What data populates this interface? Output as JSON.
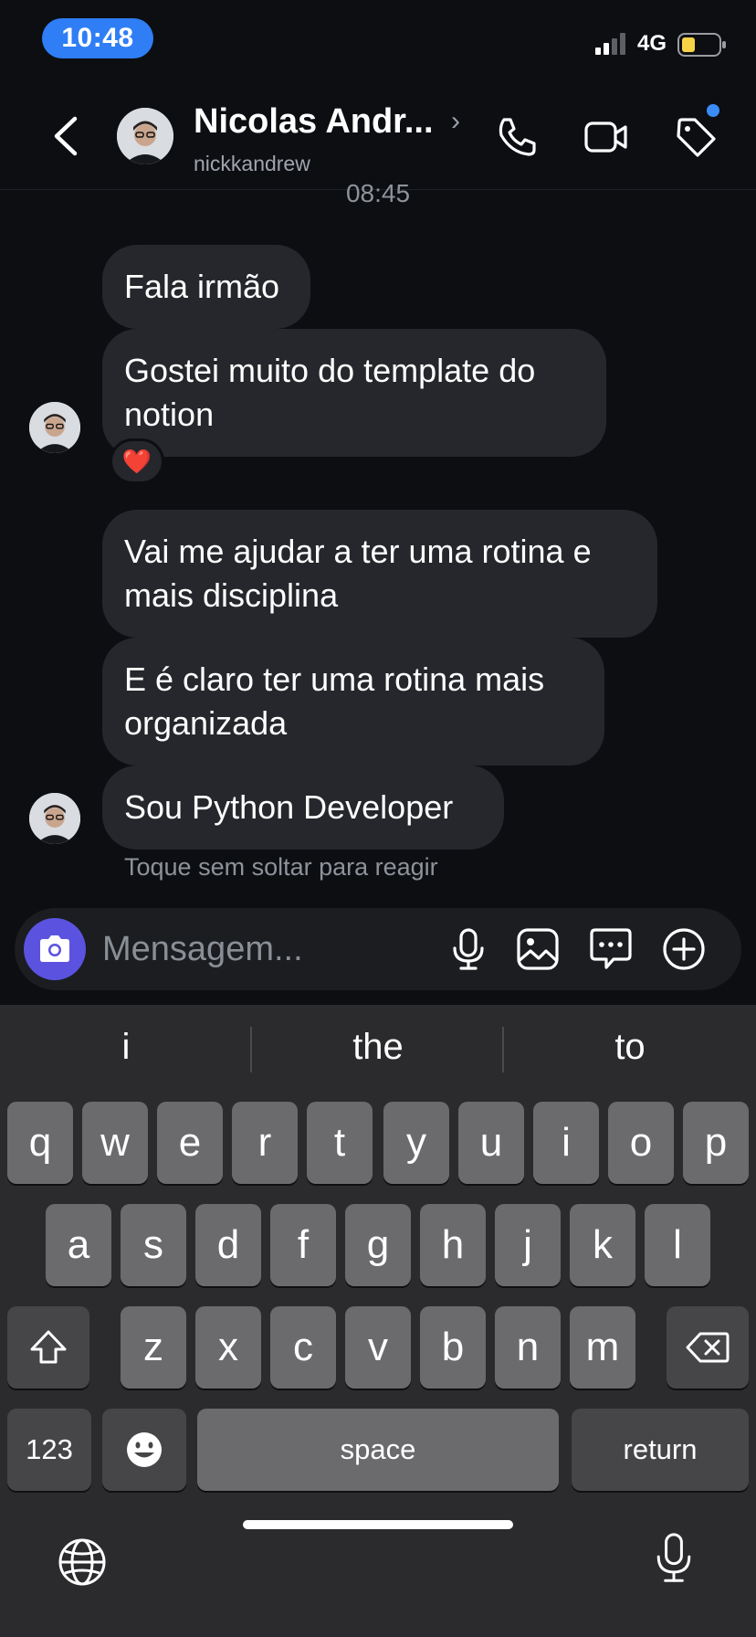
{
  "status_bar": {
    "time": "10:48",
    "network": "4G"
  },
  "header": {
    "name": "Nicolas Andr...",
    "username": "nickkandrew"
  },
  "chat": {
    "timestamp": "08:45",
    "messages": [
      "Fala irmão",
      "Gostei muito do template do notion",
      "Vai me ajudar a ter uma rotina e mais disciplina",
      "E é claro ter uma rotina mais organizada",
      "Sou Python Developer"
    ],
    "reaction": "❤️",
    "hint": "Toque sem soltar para reagir"
  },
  "composer": {
    "placeholder": "Mensagem..."
  },
  "keyboard": {
    "suggestions": [
      "i",
      "the",
      "to"
    ],
    "row1": [
      "q",
      "w",
      "e",
      "r",
      "t",
      "y",
      "u",
      "i",
      "o",
      "p"
    ],
    "row2": [
      "a",
      "s",
      "d",
      "f",
      "g",
      "h",
      "j",
      "k",
      "l"
    ],
    "row3": [
      "z",
      "x",
      "c",
      "v",
      "b",
      "n",
      "m"
    ],
    "numbers_label": "123",
    "space_label": "space",
    "return_label": "return"
  }
}
